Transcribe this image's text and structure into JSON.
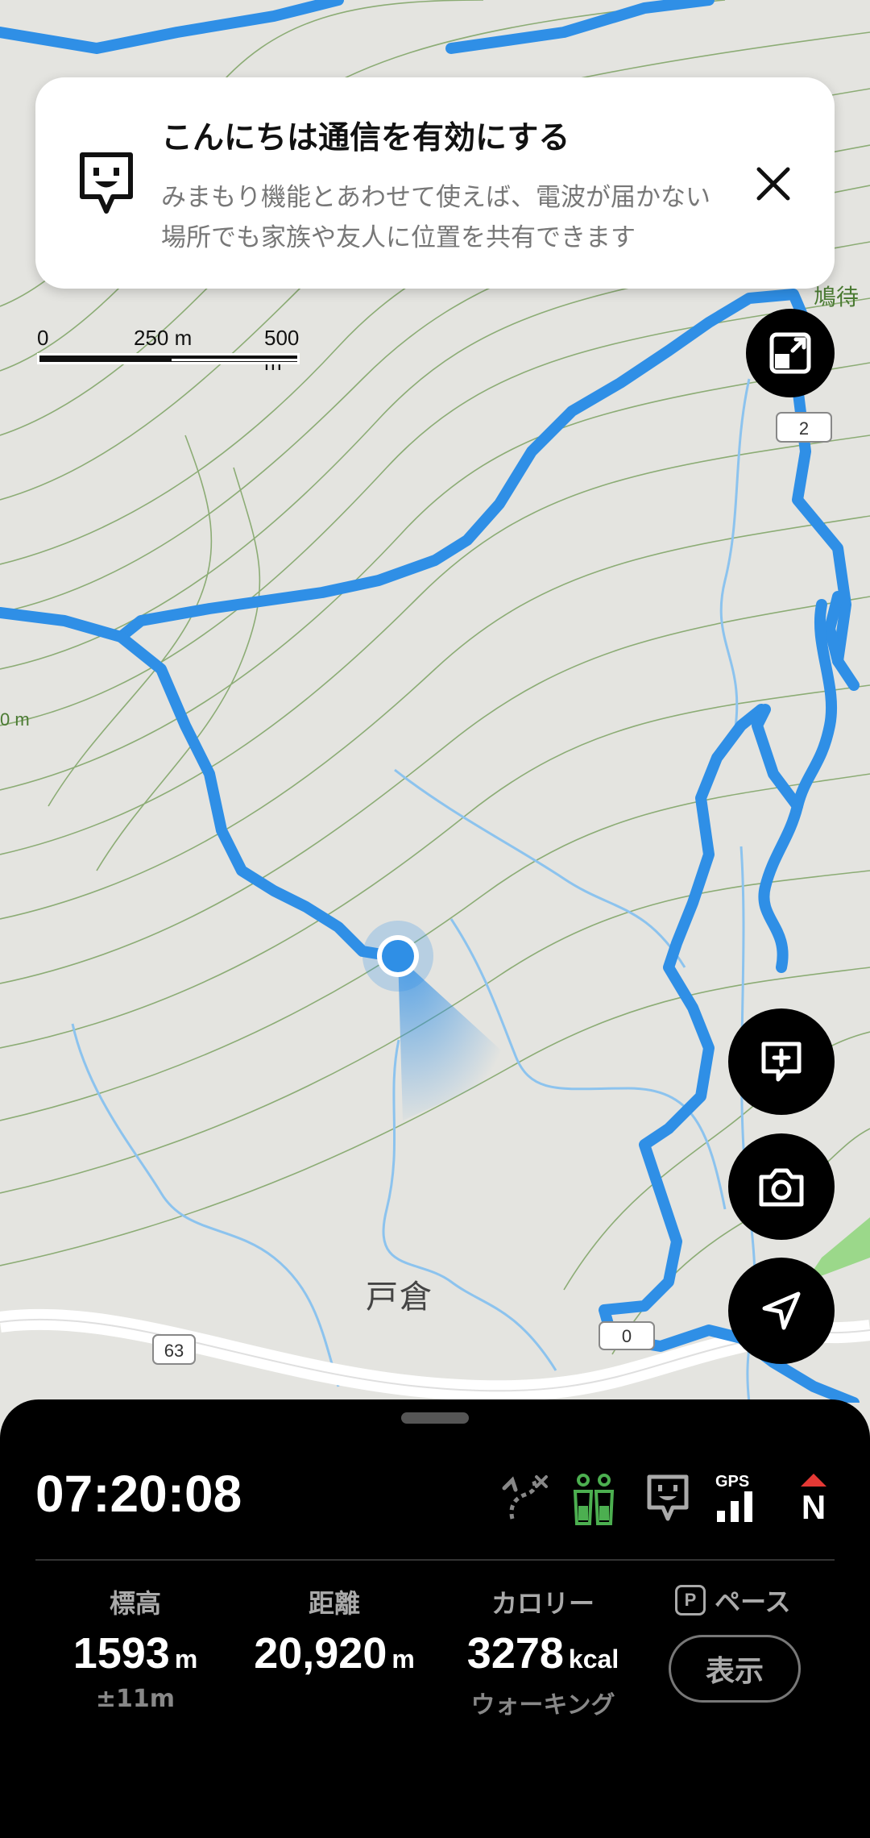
{
  "banner": {
    "title": "こんにちは通信を有効にする",
    "text": "みまもり機能とあわせて使えば、電波が届かない場所でも家族や友人に位置を共有できます"
  },
  "map": {
    "scale": {
      "label_0": "0",
      "label_250": "250 m",
      "label_500": "500 m"
    },
    "town_label": "戸倉",
    "road_63": "63",
    "road_top": "2",
    "road_bottom": "0",
    "left_edge_label": "0 m",
    "right_edge_label": "鳩待",
    "route_color": "#2f8fe6",
    "stream_color": "#8cc3ee",
    "contour_color": "#6f9a52"
  },
  "status": {
    "timer": "07:20:08",
    "gps_label": "GPS",
    "compass_label": "N",
    "accent_green": "#4caf50",
    "compass_red": "#e53935"
  },
  "stats": {
    "elevation": {
      "label": "標高",
      "value": "1593",
      "unit": "m",
      "sub": "±11m"
    },
    "distance": {
      "label": "距離",
      "value": "20,920",
      "unit": "m"
    },
    "calories": {
      "label": "カロリー",
      "value": "3278",
      "unit": "kcal",
      "sub": "ウォーキング"
    },
    "pace": {
      "badge": "P",
      "label": "ペース",
      "button": "表示"
    }
  }
}
